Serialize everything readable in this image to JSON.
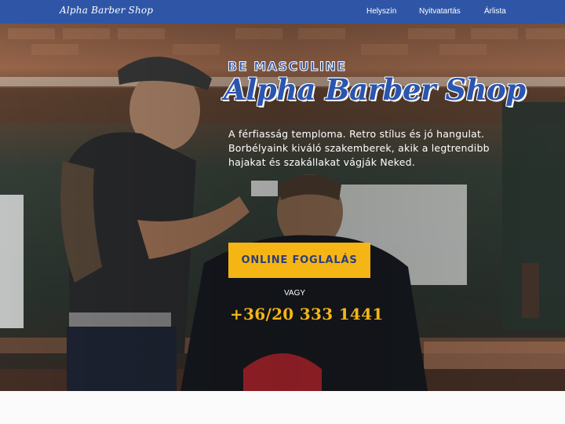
{
  "navbar": {
    "brand": "Alpha Barber Shop",
    "links": [
      "Helyszín",
      "Nyitvatartás",
      "Árlista"
    ]
  },
  "hero": {
    "tagline": "BE MASCULINE",
    "title": "Alpha Barber Shop",
    "description": "A férfiasság temploma. Retro stílus és jó hangulat. Borbélyaink kiváló szakemberek, akik a legtrendibb hajakat és szakállakat vágják Neked.",
    "cta_label": "ONLINE FOGLALÁS",
    "or_text": "VAGY",
    "phone": "+36/20 333 1441"
  },
  "colors": {
    "navbar": "#2f56a6",
    "accent": "#f5b514",
    "title": "#2a55b0"
  }
}
